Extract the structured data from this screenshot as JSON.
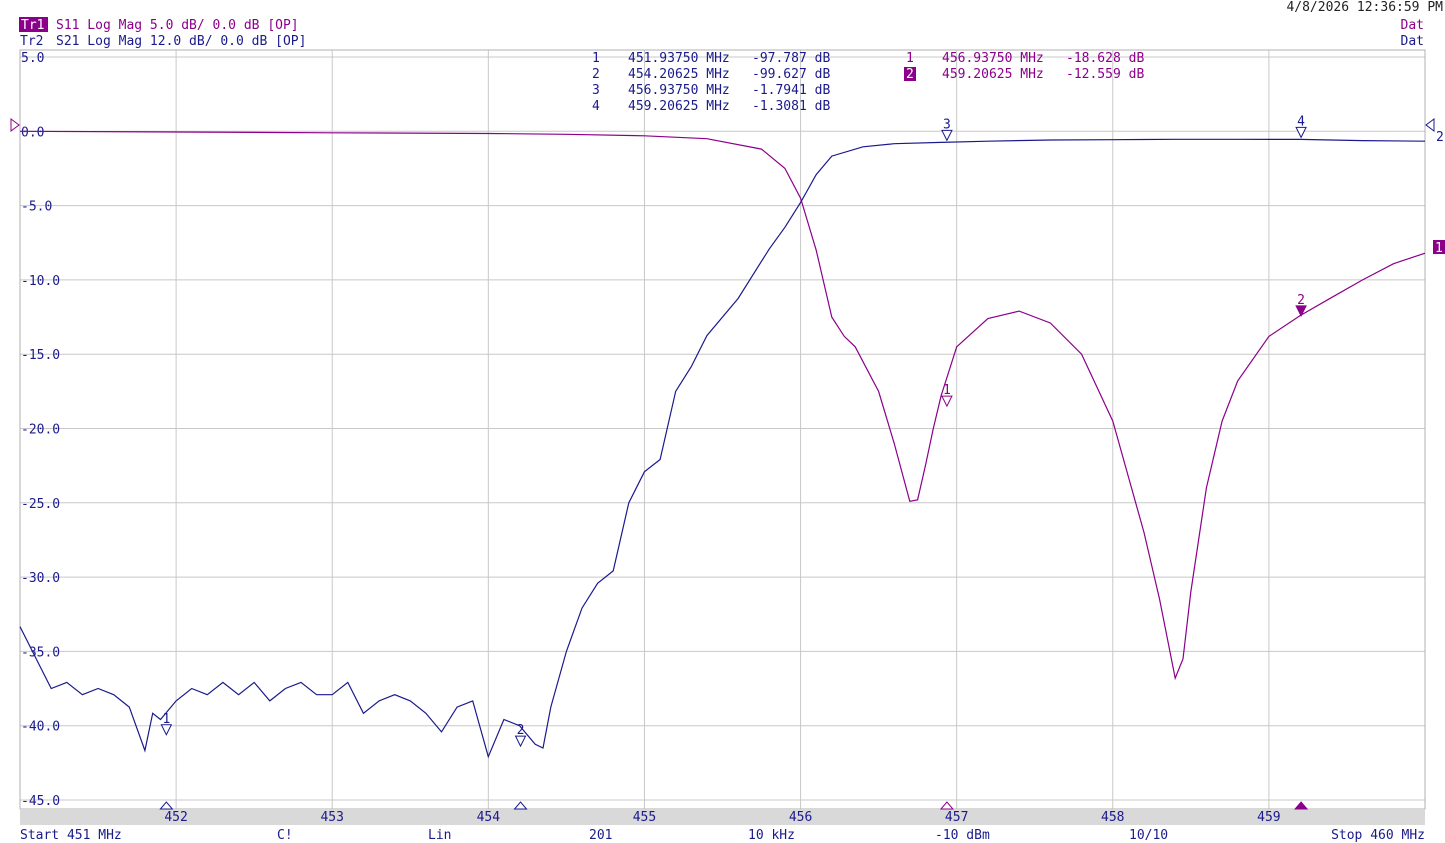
{
  "header": {
    "datetime": "4/8/2026 12:36:59 PM",
    "tr1": {
      "tag": "Tr1",
      "text": "S11 Log Mag 5.0 dB/ 0.0 dB [OP]",
      "status": "Dat"
    },
    "tr2": {
      "tag": "Tr2",
      "text": "S21 Log Mag 12.0 dB/ 0.0 dB [OP]",
      "status": "Dat"
    }
  },
  "footer": {
    "start": "Start 451 MHz",
    "cal": "C!",
    "sweep": "Lin",
    "points": "201",
    "ifbw": "10 kHz",
    "power": "-10 dBm",
    "avg": "10/10",
    "stop": "Stop 460 MHz"
  },
  "colors": {
    "s11": "#8b008b",
    "s21": "#1a1a8c",
    "grid": "#c8c8c8",
    "axis_bar": "#d9d9d9"
  },
  "marker_tables": {
    "s21": [
      {
        "id": "1",
        "freq": "451.93750 MHz",
        "value": "-97.787 dB"
      },
      {
        "id": "2",
        "freq": "454.20625 MHz",
        "value": "-99.627 dB"
      },
      {
        "id": "3",
        "freq": "456.93750 MHz",
        "value": "-1.7941 dB"
      },
      {
        "id": "4",
        "freq": "459.20625 MHz",
        "value": "-1.3081 dB"
      }
    ],
    "s11": [
      {
        "id": "1",
        "freq": "456.93750 MHz",
        "value": "-18.628 dB",
        "active": false
      },
      {
        "id": "2",
        "freq": "459.20625 MHz",
        "value": "-12.559 dB",
        "active": true
      }
    ]
  },
  "chart_data": {
    "type": "line",
    "title": "",
    "xlabel": "",
    "ylabel": "",
    "xlim": [
      451,
      460
    ],
    "ylim": [
      -45,
      5
    ],
    "grid": true,
    "x_ticks": [
      "452",
      "453",
      "454",
      "455",
      "456",
      "457",
      "458",
      "459"
    ],
    "y_ticks": [
      "5.0",
      "0.0",
      "-5.0",
      "-10.0",
      "-15.0",
      "-20.0",
      "-25.0",
      "-30.0",
      "-35.0",
      "-40.0",
      "-45.0"
    ],
    "series": [
      {
        "name": "S11",
        "x": [
          451.0,
          452.0,
          453.0,
          454.0,
          454.5,
          455.0,
          455.4,
          455.75,
          455.9,
          456.0,
          456.1,
          456.2,
          456.28,
          456.35,
          456.5,
          456.6,
          456.7,
          456.75,
          456.8,
          456.85,
          456.9,
          457.0,
          457.2,
          457.4,
          457.6,
          457.8,
          458.0,
          458.2,
          458.3,
          458.4,
          458.45,
          458.5,
          458.6,
          458.7,
          458.8,
          459.0,
          459.2,
          459.4,
          459.6,
          459.8,
          460.0
        ],
        "values": [
          0.0,
          -0.05,
          -0.1,
          -0.15,
          -0.2,
          -0.3,
          -0.5,
          -1.2,
          -2.5,
          -4.5,
          -8.0,
          -12.5,
          -13.8,
          -14.5,
          -17.5,
          -21.0,
          -24.9,
          -24.8,
          -22.5,
          -20.0,
          -17.8,
          -14.5,
          -12.6,
          -12.1,
          -12.9,
          -15.0,
          -19.5,
          -27.0,
          -31.5,
          -36.8,
          -35.5,
          -31.0,
          -24.0,
          -19.5,
          -16.8,
          -13.8,
          -12.4,
          -11.2,
          -10.0,
          -8.9,
          -8.2
        ]
      },
      {
        "name": "S21",
        "x": [
          451.0,
          451.1,
          451.2,
          451.3,
          451.4,
          451.5,
          451.6,
          451.7,
          451.8,
          451.85,
          451.9,
          452.0,
          452.1,
          452.2,
          452.3,
          452.4,
          452.5,
          452.6,
          452.7,
          452.8,
          452.9,
          453.0,
          453.1,
          453.2,
          453.3,
          453.4,
          453.5,
          453.6,
          453.7,
          453.8,
          453.9,
          454.0,
          454.1,
          454.2,
          454.3,
          454.35,
          454.4,
          454.5,
          454.6,
          454.7,
          454.8,
          454.9,
          455.0,
          455.1,
          455.2,
          455.3,
          455.4,
          455.6,
          455.8,
          455.9,
          456.0,
          456.1,
          456.2,
          456.4,
          456.6,
          456.9,
          457.2,
          457.6,
          458.0,
          458.4,
          458.8,
          459.2,
          459.6,
          460.0
        ],
        "values": [
          -80.0,
          -85.0,
          -90.0,
          -89.0,
          -91.0,
          -90.0,
          -91.0,
          -93.0,
          -100.0,
          -94.0,
          -95.0,
          -92.0,
          -90.0,
          -91.0,
          -89.0,
          -91.0,
          -89.0,
          -92.0,
          -90.0,
          -89.0,
          -91.0,
          -91.0,
          -89.0,
          -94.0,
          -92.0,
          -91.0,
          -92.0,
          -94.0,
          -97.0,
          -93.0,
          -92.0,
          -101.0,
          -95.0,
          -96.0,
          -99.0,
          -99.6,
          -93.0,
          -84.0,
          -77.0,
          -73.0,
          -71.0,
          -60.0,
          -55.0,
          -53.0,
          -42.0,
          -38.0,
          -33.0,
          -27.0,
          -19.0,
          -15.5,
          -11.5,
          -7.0,
          -4.0,
          -2.5,
          -2.0,
          -1.8,
          -1.6,
          -1.4,
          -1.35,
          -1.3,
          -1.3,
          -1.31,
          -1.5,
          -1.6
        ]
      }
    ],
    "markers": {
      "s21": [
        {
          "id": "1",
          "x": 451.9375,
          "y": -97.787
        },
        {
          "id": "2",
          "x": 454.20625,
          "y": -99.627
        },
        {
          "id": "3",
          "x": 456.9375,
          "y": -1.7941
        },
        {
          "id": "4",
          "x": 459.20625,
          "y": -1.3081
        }
      ],
      "s11": [
        {
          "id": "1",
          "x": 456.9375,
          "y": -18.628
        },
        {
          "id": "2",
          "x": 459.20625,
          "y": -12.559
        }
      ]
    },
    "ref_labels": {
      "s11": "1",
      "s21": "2"
    }
  }
}
